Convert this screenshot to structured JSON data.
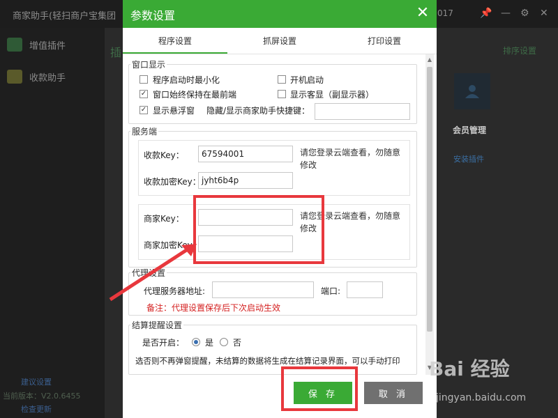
{
  "background": {
    "app_title": "商家助手(轻扫商户宝集团",
    "version_fragment": "017",
    "sidebar": [
      "增值插件",
      "收款助手"
    ],
    "tab_fragment": "插",
    "sort_link": "排序设置",
    "member_label": "会员管理",
    "install_link": "安装插件",
    "footer": [
      "建议设置",
      "当前版本：V2.0.6455",
      "检查更新"
    ],
    "watermark_brand": "Bai 经验",
    "watermark_url": "jingyan.baidu.com"
  },
  "dialog": {
    "title": "参数设置",
    "tabs": [
      "程序设置",
      "抓屏设置",
      "打印设置"
    ],
    "window": {
      "legend": "窗口显示",
      "minimize_on_start": {
        "label": "程序启动时最小化",
        "checked": false
      },
      "auto_start": {
        "label": "开机启动",
        "checked": false
      },
      "always_on_top": {
        "label": "窗口始终保持在最前端",
        "checked": true
      },
      "customer_display": {
        "label": "显示客显（副显示器）",
        "checked": false
      },
      "floating_window": {
        "label": "显示悬浮窗",
        "checked": true
      },
      "hotkey_label": "隐藏/显示商家助手快捷键：",
      "hotkey_value": ""
    },
    "server": {
      "legend": "服务端",
      "collect_key_label": "收款Key：",
      "collect_key_value": "67594001",
      "collect_secret_label": "收款加密Key：",
      "collect_secret_value": "jyht6b4p",
      "note1": "请您登录云端查看，勿随意修改",
      "merchant_key_label": "商家Key：",
      "merchant_key_value": "",
      "merchant_secret_label": "商家加密Key：",
      "merchant_secret_value": "",
      "note2": "请您登录云端查看，勿随意修改"
    },
    "proxy": {
      "legend": "代理设置",
      "address_label": "代理服务器地址:",
      "address_value": "",
      "port_label": "端口:",
      "port_value": "",
      "remark": "备注：代理设置保存后下次启动生效"
    },
    "settlement": {
      "legend": "结算提醒设置",
      "enable_label": "是否开启：",
      "yes_label": "是",
      "no_label": "否",
      "selected": "是",
      "desc": "选否则不再弹窗提醒，未结算的数据将生成在结算记录界面，可以手动打印"
    },
    "save_label": "保 存",
    "cancel_label": "取 消"
  },
  "colors": {
    "brand_green": "#3aaa35",
    "annotation_red": "#e8383d",
    "remark_red": "#d42020"
  }
}
